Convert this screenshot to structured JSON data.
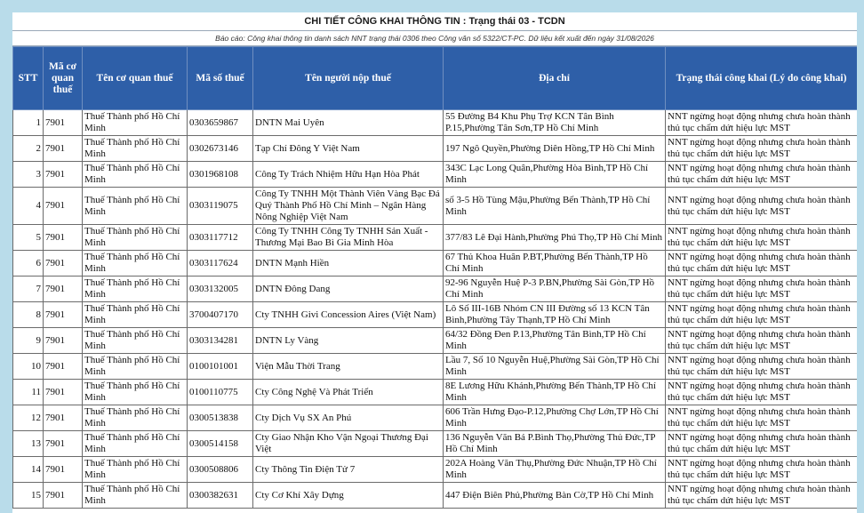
{
  "header": {
    "title": "CHI TIẾT CÔNG KHAI THÔNG TIN : Trạng thái 03 - TCDN",
    "subtitle": "Báo cáo: Công khai thông tin danh sách NNT trạng thái 0306 theo Công văn số 5322/CT-PC. Dữ liệu kết xuất đến ngày 31/08/2026"
  },
  "columns": [
    "STT",
    "Mã cơ quan thuế",
    "Tên cơ quan thuế",
    "Mã số thuế",
    "Tên người nộp thuế",
    "Địa chỉ",
    "Trạng thái công khai (Lý do công khai)"
  ],
  "rows": [
    {
      "stt": "1",
      "ma_cq": "7901",
      "ten_cq": "Thuế Thành phố Hồ Chí Minh",
      "mst": "0303659867",
      "ten_nnt": "DNTN Mai Uyên",
      "dia_chi": "55 Đường B4 Khu Phụ Trợ KCN Tân Bình P.15,Phường Tân Sơn,TP Hồ Chí Minh",
      "trang_thai": "NNT ngừng hoạt động nhưng chưa hoàn thành thủ tục chấm dứt hiệu lực MST"
    },
    {
      "stt": "2",
      "ma_cq": "7901",
      "ten_cq": "Thuế Thành phố Hồ Chí Minh",
      "mst": "0302673146",
      "ten_nnt": "Tạp Chí Đông Y Việt Nam",
      "dia_chi": "197 Ngô Quyền,Phường Diên Hồng,TP Hồ Chí Minh",
      "trang_thai": "NNT ngừng hoạt động nhưng chưa hoàn thành thủ tục chấm dứt hiệu lực MST"
    },
    {
      "stt": "3",
      "ma_cq": "7901",
      "ten_cq": "Thuế Thành phố Hồ Chí Minh",
      "mst": "0301968108",
      "ten_nnt": "Công Ty Trách Nhiệm Hữu Hạn Hòa Phát",
      "dia_chi": "343C Lạc Long Quân,Phường Hòa Bình,TP Hồ Chí Minh",
      "trang_thai": "NNT ngừng hoạt động nhưng chưa hoàn thành thủ tục chấm dứt hiệu lực MST"
    },
    {
      "stt": "4",
      "ma_cq": "7901",
      "ten_cq": "Thuế Thành phố Hồ Chí Minh",
      "mst": "0303119075",
      "ten_nnt": "Công Ty TNHH Một Thành Viên Vàng Bạc Đá Quý Thành Phố Hồ Chí Minh – Ngân Hàng Nông Nghiệp Việt Nam",
      "dia_chi": "số 3-5 Hồ Tùng Mậu,Phường Bến Thành,TP Hồ Chí Minh",
      "trang_thai": "NNT ngừng hoạt động nhưng chưa hoàn thành thủ tục chấm dứt hiệu lực MST",
      "tall": true
    },
    {
      "stt": "5",
      "ma_cq": "7901",
      "ten_cq": "Thuế Thành phố Hồ Chí Minh",
      "mst": "0303117712",
      "ten_nnt": "Công Ty TNHH Công Ty TNHH Sản Xuất - Thương Mại Bao Bì Gia Minh Hòa",
      "dia_chi": "377/83 Lê Đại Hành,Phường Phú Thọ,TP Hồ Chí Minh",
      "trang_thai": "NNT ngừng hoạt động nhưng chưa hoàn thành thủ tục chấm dứt hiệu lực MST"
    },
    {
      "stt": "6",
      "ma_cq": "7901",
      "ten_cq": "Thuế Thành phố Hồ Chí Minh",
      "mst": "0303117624",
      "ten_nnt": "DNTN Mạnh Hiền",
      "dia_chi": "67 Thủ Khoa Huân P.BT,Phường Bến Thành,TP Hồ Chí Minh",
      "trang_thai": "NNT ngừng hoạt động nhưng chưa hoàn thành thủ tục chấm dứt hiệu lực MST"
    },
    {
      "stt": "7",
      "ma_cq": "7901",
      "ten_cq": "Thuế Thành phố Hồ Chí Minh",
      "mst": "0303132005",
      "ten_nnt": "DNTN Đông Dang",
      "dia_chi": "92-96 Nguyễn Huệ P-3 P.BN,Phường Sài Gòn,TP Hồ Chí Minh",
      "trang_thai": "NNT ngừng hoạt động nhưng chưa hoàn thành thủ tục chấm dứt hiệu lực MST"
    },
    {
      "stt": "8",
      "ma_cq": "7901",
      "ten_cq": "Thuế Thành phố Hồ Chí Minh",
      "mst": "3700407170",
      "ten_nnt": "Cty TNHH Givi Concession Aires (Việt Nam)",
      "dia_chi": "Lô Số III-16B Nhóm CN III Đường số 13 KCN Tân Bình,Phường Tây Thạnh,TP Hồ Chí Minh",
      "trang_thai": "NNT ngừng hoạt động nhưng chưa hoàn thành thủ tục chấm dứt hiệu lực MST"
    },
    {
      "stt": "9",
      "ma_cq": "7901",
      "ten_cq": "Thuế Thành phố Hồ Chí Minh",
      "mst": "0303134281",
      "ten_nnt": "DNTN Ly Vàng",
      "dia_chi": "64/32 Đồng Đen P.13,Phường Tân Bình,TP Hồ Chí Minh",
      "trang_thai": "NNT ngừng hoạt động nhưng chưa hoàn thành thủ tục chấm dứt hiệu lực MST"
    },
    {
      "stt": "10",
      "ma_cq": "7901",
      "ten_cq": "Thuế Thành phố Hồ Chí Minh",
      "mst": "0100101001",
      "ten_nnt": "Viện Mẫu Thời Trang",
      "dia_chi": "Lầu 7, Số 10 Nguyễn Huệ,Phường Sài Gòn,TP Hồ Chí Minh",
      "trang_thai": "NNT ngừng hoạt động nhưng chưa hoàn thành thủ tục chấm dứt hiệu lực MST"
    },
    {
      "stt": "11",
      "ma_cq": "7901",
      "ten_cq": "Thuế Thành phố Hồ Chí Minh",
      "mst": "0100110775",
      "ten_nnt": "Cty Công Nghệ Và Phát Triển",
      "dia_chi": "8E Lương Hữu Khánh,Phường Bến Thành,TP Hồ Chí Minh",
      "trang_thai": "NNT ngừng hoạt động nhưng chưa hoàn thành thủ tục chấm dứt hiệu lực MST"
    },
    {
      "stt": "12",
      "ma_cq": "7901",
      "ten_cq": "Thuế Thành phố Hồ Chí Minh",
      "mst": "0300513838",
      "ten_nnt": "Cty Dịch Vụ SX An Phú",
      "dia_chi": "606 Trần Hưng Đạo-P.12,Phường Chợ Lớn,TP Hồ Chí Minh",
      "trang_thai": "NNT ngừng hoạt động nhưng chưa hoàn thành thủ tục chấm dứt hiệu lực MST"
    },
    {
      "stt": "13",
      "ma_cq": "7901",
      "ten_cq": "Thuế Thành phố Hồ Chí Minh",
      "mst": "0300514158",
      "ten_nnt": "Cty Giao Nhận Kho Vận Ngoại Thương Đại Việt",
      "dia_chi": "136 Nguyễn Văn Bá P.Bình Thọ,Phường Thủ Đức,TP Hồ Chí Minh",
      "trang_thai": "NNT ngừng hoạt động nhưng chưa hoàn thành thủ tục chấm dứt hiệu lực MST"
    },
    {
      "stt": "14",
      "ma_cq": "7901",
      "ten_cq": "Thuế Thành phố Hồ Chí Minh",
      "mst": "0300508806",
      "ten_nnt": "Cty Thông Tin Điện Tử 7",
      "dia_chi": "202A Hoàng Văn Thụ,Phường Đức Nhuận,TP Hồ Chí Minh",
      "trang_thai": "NNT ngừng hoạt động nhưng chưa hoàn thành thủ tục chấm dứt hiệu lực MST"
    },
    {
      "stt": "15",
      "ma_cq": "7901",
      "ten_cq": "Thuế Thành phố Hồ Chí Minh",
      "mst": "0300382631",
      "ten_nnt": "Cty Cơ Khí Xây Dựng",
      "dia_chi": "447 Điện Biên Phủ,Phường Bàn Cờ,TP Hồ Chí Minh",
      "trang_thai": "NNT ngừng hoạt động nhưng chưa hoàn thành thủ tục chấm dứt hiệu lực MST"
    }
  ]
}
